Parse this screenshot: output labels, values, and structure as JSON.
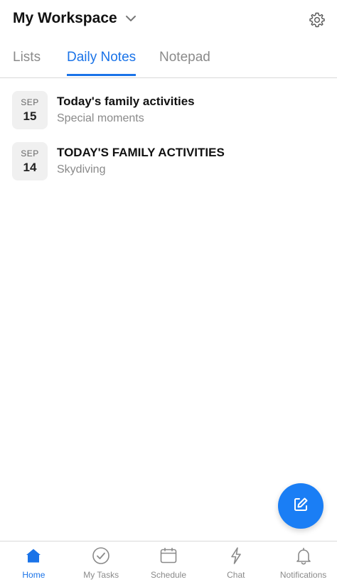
{
  "header": {
    "workspace_title": "My Workspace",
    "chevron_icon": "chevron-down-icon",
    "settings_icon": "gear-icon"
  },
  "tabs": [
    {
      "label": "Lists",
      "active": false
    },
    {
      "label": "Daily Notes",
      "active": true
    },
    {
      "label": "Notepad",
      "active": false
    }
  ],
  "notes": [
    {
      "month": "SEP",
      "day": "15",
      "title": "Today's family activities",
      "subtitle": "Special moments"
    },
    {
      "month": "SEP",
      "day": "14",
      "title": "TODAY'S FAMILY ACTIVITIES",
      "subtitle": "Skydiving"
    }
  ],
  "fab": {
    "icon": "edit-icon"
  },
  "bottom_nav": [
    {
      "label": "Home",
      "icon": "home-icon",
      "active": true
    },
    {
      "label": "My Tasks",
      "icon": "check-circle-icon",
      "active": false
    },
    {
      "label": "Schedule",
      "icon": "calendar-icon",
      "active": false
    },
    {
      "label": "Chat",
      "icon": "lightning-icon",
      "active": false
    },
    {
      "label": "Notifications",
      "icon": "bell-icon",
      "active": false
    }
  ],
  "colors": {
    "accent": "#1a73e8",
    "fab": "#1a7ef5",
    "muted_text": "#8a8a8a",
    "badge_bg": "#f0f0f0"
  }
}
